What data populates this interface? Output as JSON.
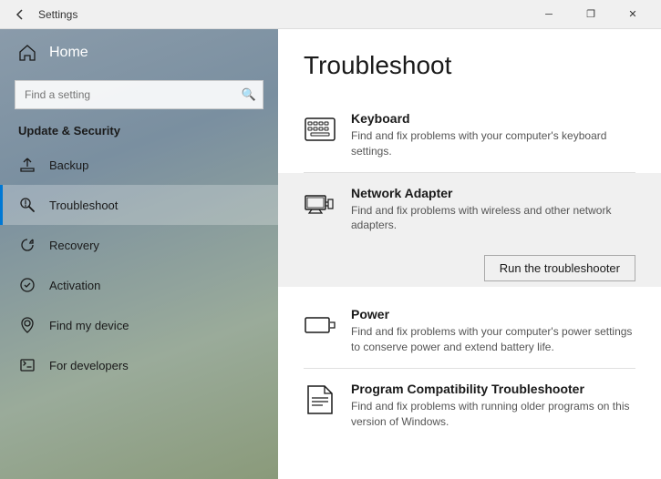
{
  "titlebar": {
    "title": "Settings",
    "back_label": "←",
    "minimize_label": "─",
    "restore_label": "❐",
    "close_label": "✕"
  },
  "sidebar": {
    "home_label": "Home",
    "search_placeholder": "Find a setting",
    "search_icon": "🔍",
    "section_title": "Update & Security",
    "items": [
      {
        "id": "backup",
        "label": "Backup",
        "icon": "backup"
      },
      {
        "id": "troubleshoot",
        "label": "Troubleshoot",
        "icon": "troubleshoot",
        "active": true
      },
      {
        "id": "recovery",
        "label": "Recovery",
        "icon": "recovery"
      },
      {
        "id": "activation",
        "label": "Activation",
        "icon": "activation"
      },
      {
        "id": "find-my-device",
        "label": "Find my device",
        "icon": "find-my-device"
      },
      {
        "id": "for-developers",
        "label": "For developers",
        "icon": "for-developers"
      }
    ]
  },
  "content": {
    "title": "Troubleshoot",
    "items": [
      {
        "id": "keyboard",
        "title": "Keyboard",
        "desc": "Find and fix problems with your computer's keyboard settings.",
        "icon": "keyboard"
      },
      {
        "id": "network-adapter",
        "title": "Network Adapter",
        "desc": "Find and fix problems with wireless and other network adapters.",
        "icon": "network",
        "highlighted": true
      },
      {
        "id": "power",
        "title": "Power",
        "desc": "Find and fix problems with your computer's power settings to conserve power and extend battery life.",
        "icon": "power"
      },
      {
        "id": "program-compatibility",
        "title": "Program Compatibility Troubleshooter",
        "desc": "Find and fix problems with running older programs on this version of Windows.",
        "icon": "program-compat"
      }
    ],
    "run_button_label": "Run the troubleshooter"
  }
}
